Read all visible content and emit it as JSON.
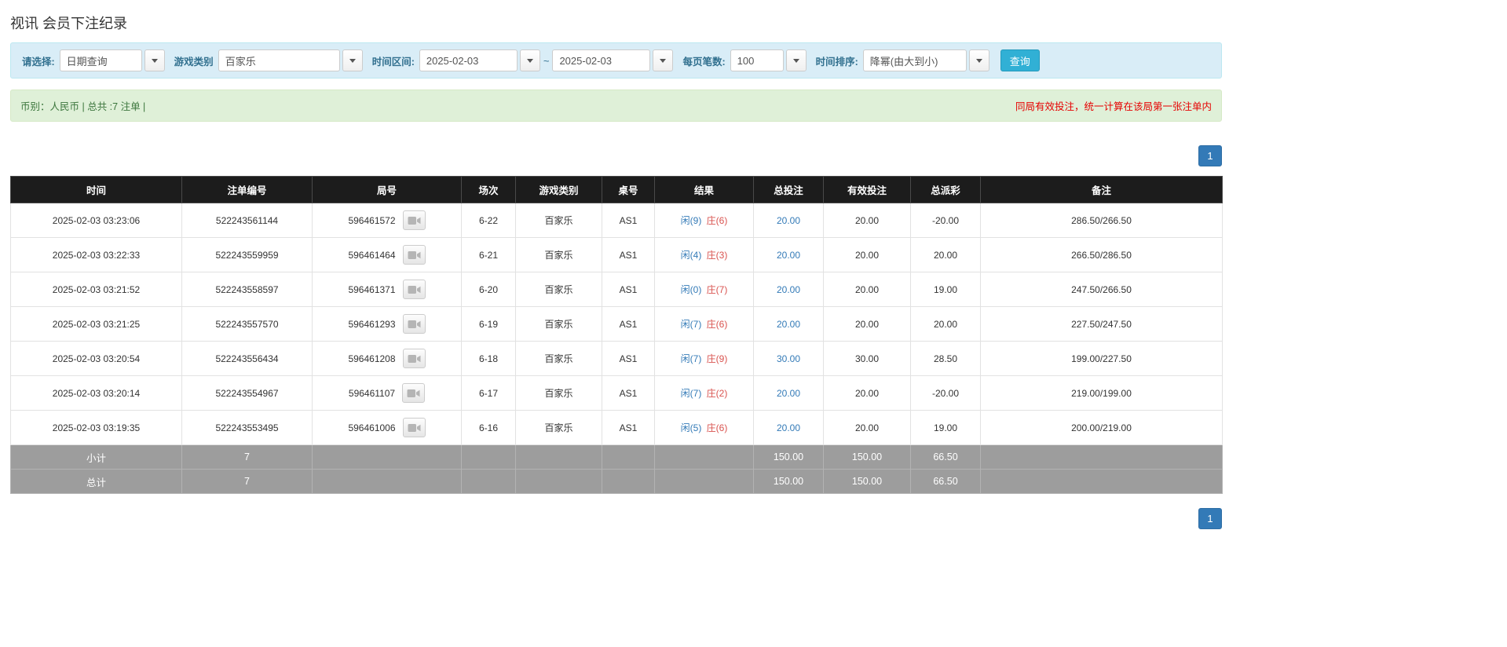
{
  "page": {
    "title": "视讯 会员下注纪录"
  },
  "filters": {
    "select_label": "请选择:",
    "select_value": "日期查询",
    "game_type_label": "游戏类别",
    "game_type_value": "百家乐",
    "date_range_label": "时间区间:",
    "date_from": "2025-02-03",
    "date_separator": "~",
    "date_to": "2025-02-03",
    "page_size_label": "每页笔数:",
    "page_size_value": "100",
    "sort_label": "时间排序:",
    "sort_value": "降幂(由大到小)",
    "search_button": "查询"
  },
  "info_bar": {
    "summary": "币别：人民币 | 总共 :7 注单 |",
    "notice": "同局有效投注，统一计算在该局第一张注单内"
  },
  "pagination": {
    "page": "1"
  },
  "table": {
    "headers": [
      "时间",
      "注单编号",
      "局号",
      "场次",
      "游戏类别",
      "桌号",
      "结果",
      "总投注",
      "有效投注",
      "总派彩",
      "备注"
    ],
    "rows": [
      {
        "time": "2025-02-03 03:23:06",
        "bet_id": "522243561144",
        "round_id": "596461572",
        "session": "6-22",
        "game_type": "百家乐",
        "table_id": "AS1",
        "result_player": "闲(9)",
        "result_banker": "庄(6)",
        "total_bet": "20.00",
        "valid_bet": "20.00",
        "payout": "-20.00",
        "remark": "286.50/266.50"
      },
      {
        "time": "2025-02-03 03:22:33",
        "bet_id": "522243559959",
        "round_id": "596461464",
        "session": "6-21",
        "game_type": "百家乐",
        "table_id": "AS1",
        "result_player": "闲(4)",
        "result_banker": "庄(3)",
        "total_bet": "20.00",
        "valid_bet": "20.00",
        "payout": "20.00",
        "remark": "266.50/286.50"
      },
      {
        "time": "2025-02-03 03:21:52",
        "bet_id": "522243558597",
        "round_id": "596461371",
        "session": "6-20",
        "game_type": "百家乐",
        "table_id": "AS1",
        "result_player": "闲(0)",
        "result_banker": "庄(7)",
        "total_bet": "20.00",
        "valid_bet": "20.00",
        "payout": "19.00",
        "remark": "247.50/266.50"
      },
      {
        "time": "2025-02-03 03:21:25",
        "bet_id": "522243557570",
        "round_id": "596461293",
        "session": "6-19",
        "game_type": "百家乐",
        "table_id": "AS1",
        "result_player": "闲(7)",
        "result_banker": "庄(6)",
        "total_bet": "20.00",
        "valid_bet": "20.00",
        "payout": "20.00",
        "remark": "227.50/247.50"
      },
      {
        "time": "2025-02-03 03:20:54",
        "bet_id": "522243556434",
        "round_id": "596461208",
        "session": "6-18",
        "game_type": "百家乐",
        "table_id": "AS1",
        "result_player": "闲(7)",
        "result_banker": "庄(9)",
        "total_bet": "30.00",
        "valid_bet": "30.00",
        "payout": "28.50",
        "remark": "199.00/227.50"
      },
      {
        "time": "2025-02-03 03:20:14",
        "bet_id": "522243554967",
        "round_id": "596461107",
        "session": "6-17",
        "game_type": "百家乐",
        "table_id": "AS1",
        "result_player": "闲(7)",
        "result_banker": "庄(2)",
        "total_bet": "20.00",
        "valid_bet": "20.00",
        "payout": "-20.00",
        "remark": "219.00/199.00"
      },
      {
        "time": "2025-02-03 03:19:35",
        "bet_id": "522243553495",
        "round_id": "596461006",
        "session": "6-16",
        "game_type": "百家乐",
        "table_id": "AS1",
        "result_player": "闲(5)",
        "result_banker": "庄(6)",
        "total_bet": "20.00",
        "valid_bet": "20.00",
        "payout": "19.00",
        "remark": "200.00/219.00"
      }
    ],
    "subtotal": {
      "label": "小计",
      "count": "7",
      "total_bet": "150.00",
      "valid_bet": "150.00",
      "payout": "66.50"
    },
    "total": {
      "label": "总计",
      "count": "7",
      "total_bet": "150.00",
      "valid_bet": "150.00",
      "payout": "66.50"
    }
  }
}
